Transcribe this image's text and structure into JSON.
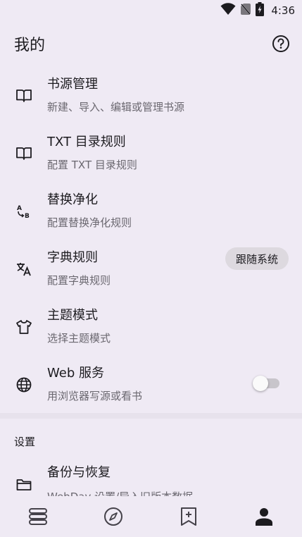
{
  "status_bar": {
    "time": "4:36",
    "icons": [
      "wifi-icon",
      "no-sim-icon",
      "battery-charging-icon"
    ]
  },
  "app_bar": {
    "title": "我的",
    "help_icon": "help-circle-icon"
  },
  "items": [
    {
      "icon": "book-open-icon",
      "title": "书源管理",
      "subtitle": "新建、导入、编辑或管理书源"
    },
    {
      "icon": "book-open-icon",
      "title": "TXT 目录规则",
      "subtitle": "配置 TXT 目录规则"
    },
    {
      "icon": "replace-ab-icon",
      "title": "替换净化",
      "subtitle": "配置替换净化规则"
    },
    {
      "icon": "translate-icon",
      "title": "字典规则",
      "subtitle": "配置字典规则"
    },
    {
      "icon": "shirt-icon",
      "title": "主题模式",
      "subtitle": "选择主题模式",
      "value": "跟随系统"
    },
    {
      "icon": "globe-icon",
      "title": "Web 服务",
      "subtitle": "用浏览器写源或看书",
      "toggle": false
    }
  ],
  "settings": {
    "section_label": "设置",
    "backup": {
      "icon": "folder-icon",
      "title": "备份与恢复",
      "subtitle": "WebDav 设置/导入旧版本数据"
    }
  },
  "bottom_nav": [
    {
      "icon": "bookshelf-icon",
      "active": false
    },
    {
      "icon": "compass-icon",
      "active": false
    },
    {
      "icon": "bookmark-add-icon",
      "active": false
    },
    {
      "icon": "person-icon",
      "active": true
    }
  ],
  "colors": {
    "background": "#efeaf4",
    "text": "#1c1b1f",
    "subtext": "#6b6870",
    "chip": "#ddd9df"
  }
}
